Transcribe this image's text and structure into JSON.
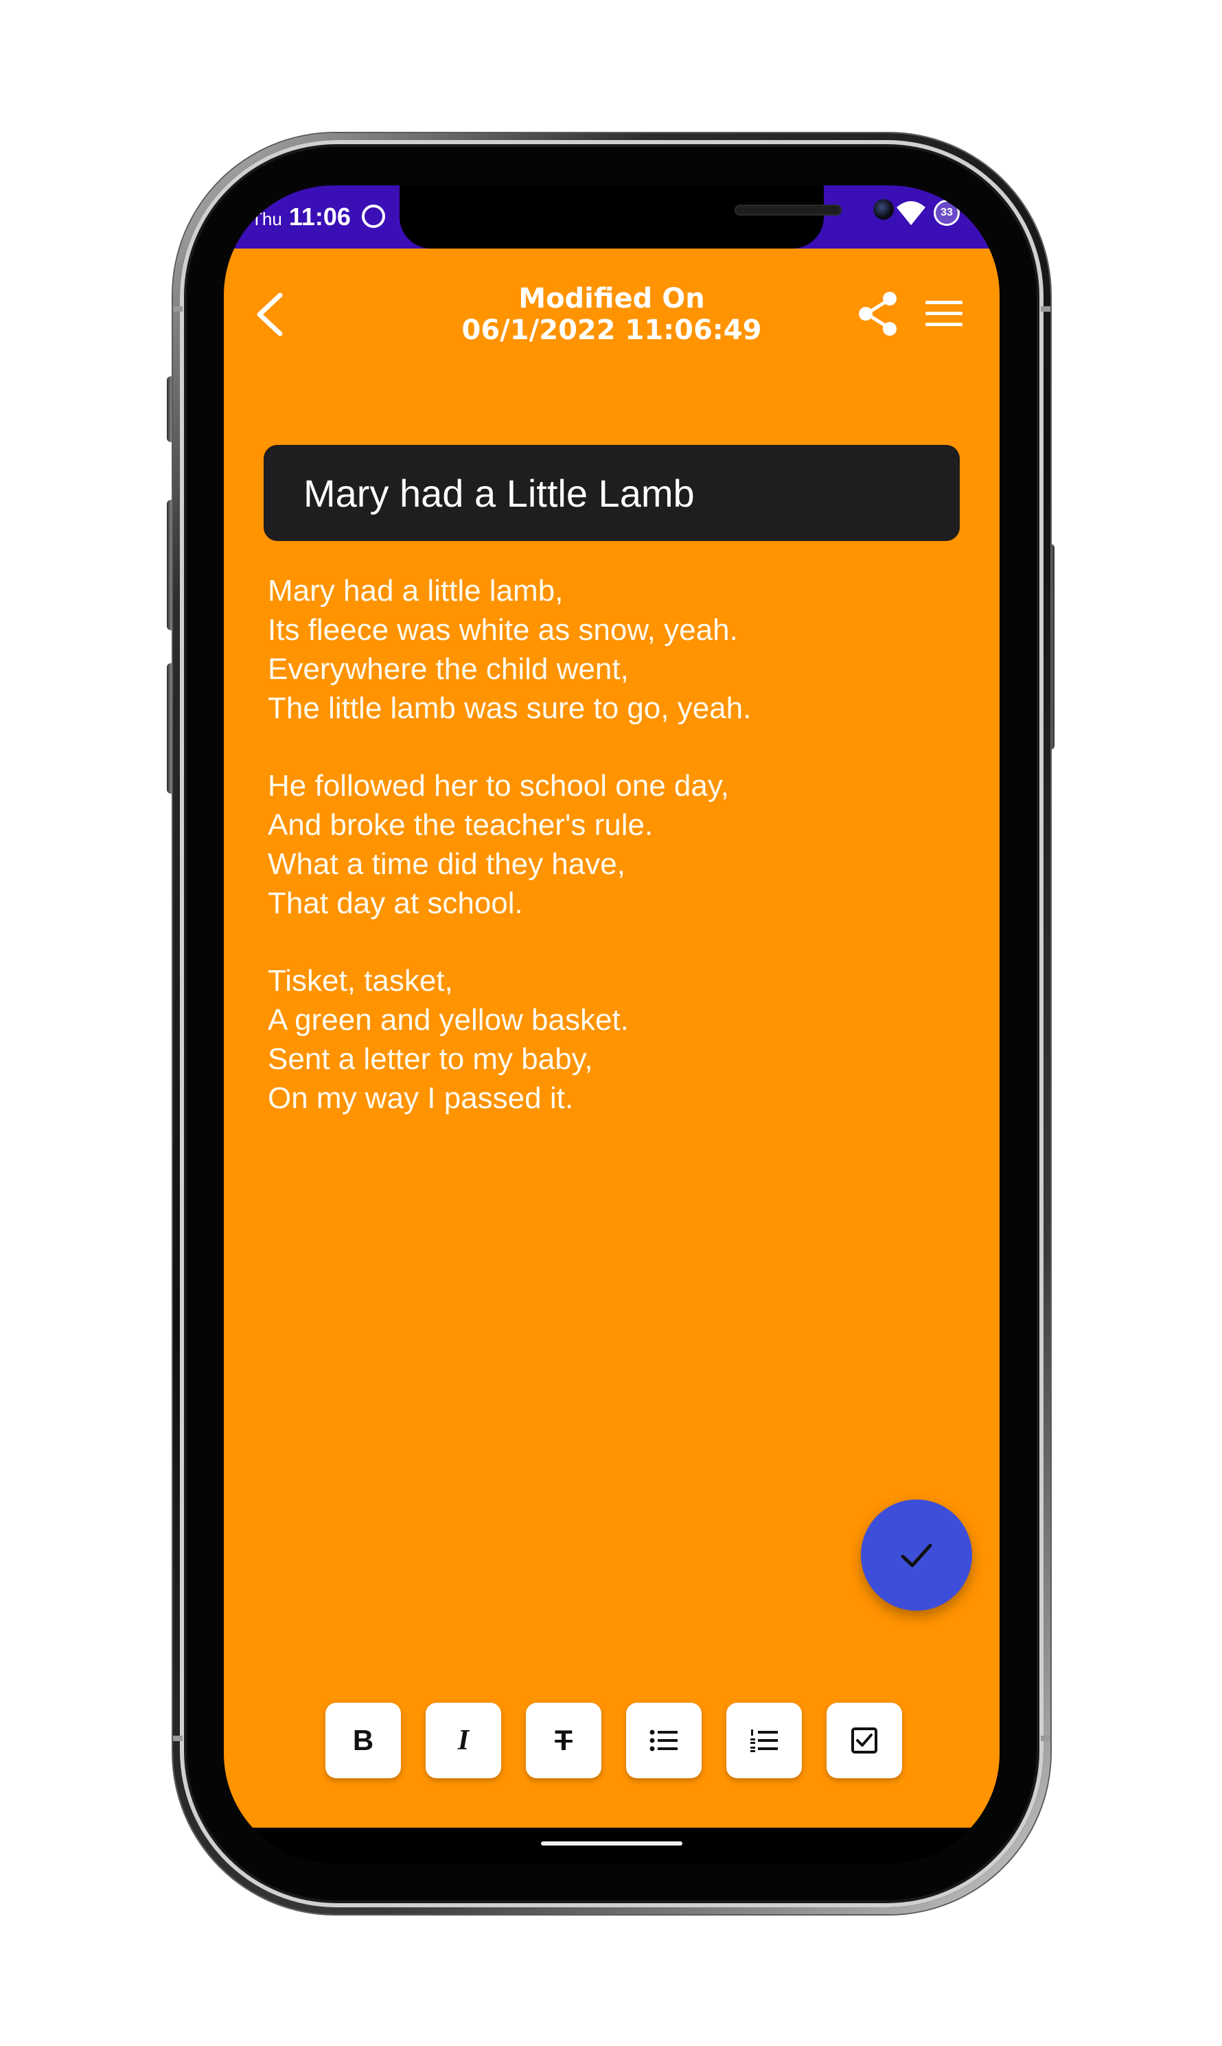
{
  "status_bar": {
    "day": "Thu",
    "time": "11:06",
    "battery": "33",
    "app_icon": "whatsapp-icon",
    "wifi_icon": "wifi-icon"
  },
  "header": {
    "modified_label": "Modified On",
    "modified_value": "06/1/2022 11:06:49",
    "back_icon": "chevron-left-icon",
    "share_icon": "share-icon",
    "menu_icon": "hamburger-menu-icon"
  },
  "note": {
    "title": "Mary had a Little Lamb",
    "stanzas": [
      [
        "Mary had a little lamb,",
        "Its fleece was white as snow, yeah.",
        "Everywhere the child went,",
        "The little lamb was sure to go, yeah."
      ],
      [
        "He followed her to school one day,",
        "And broke the teacher's rule.",
        "What a time did they have,",
        "That day at school."
      ],
      [
        "Tisket, tasket,",
        "A green and yellow basket.",
        "Sent a letter to my baby,",
        "On my way I passed it."
      ]
    ]
  },
  "fab": {
    "icon": "checkmark-icon"
  },
  "format_toolbar": {
    "bold": "B",
    "italic": "I",
    "strikethrough": "T",
    "icons": [
      "bold-icon",
      "italic-icon",
      "strikethrough-icon",
      "bullet-list-icon",
      "numbered-list-icon",
      "checkbox-icon"
    ]
  },
  "colors": {
    "note_background": "#ff9300",
    "status_bar": "#3a0fb5",
    "title_box": "#1e1d1f",
    "fab": "#3d4fd8",
    "text": "#ffffff"
  }
}
